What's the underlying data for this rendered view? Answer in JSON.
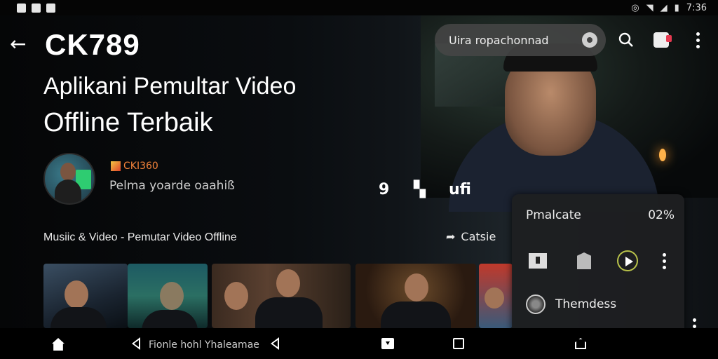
{
  "status_bar": {
    "time": "7:36"
  },
  "header": {
    "title": "CK789",
    "search_placeholder": "Uira ropachonnad"
  },
  "hero": {
    "line1": "Aplikani Pemultar Video",
    "line2": "Offline Terbaik"
  },
  "channel": {
    "name": "CKI360",
    "subtitle": "Pelma yoarde oaahiß"
  },
  "actions": {
    "action_3": "ufi"
  },
  "section": {
    "title": "Musiic & Video - Pemutar Video Offline",
    "share_label": "Catsie"
  },
  "panel": {
    "title": "Pmalcate",
    "percent": "02%",
    "row_label": "Themdess"
  },
  "navbar": {
    "label": "Fionle hohl Yhaleamae"
  }
}
